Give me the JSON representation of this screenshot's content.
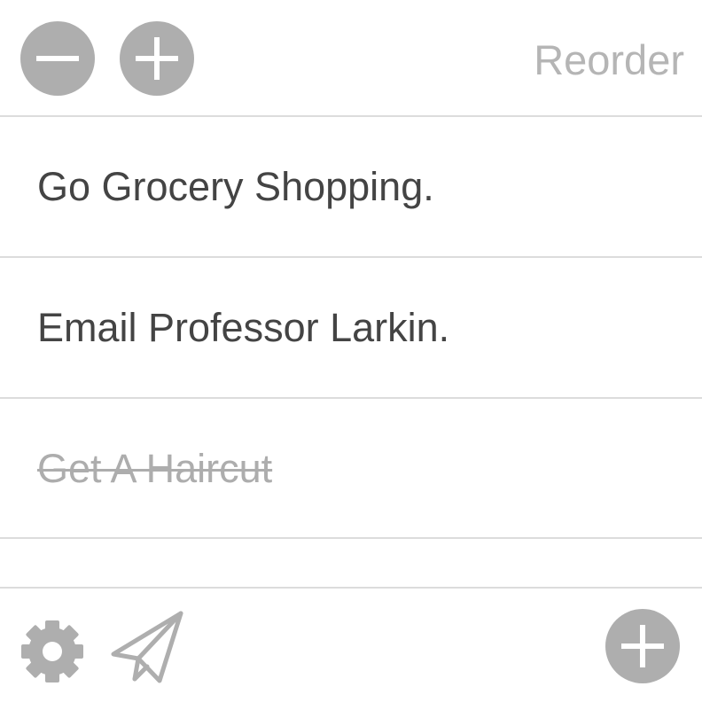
{
  "toolbar": {
    "reorder_label": "Reorder",
    "icons": [
      "minus-icon",
      "plus-icon"
    ]
  },
  "tasks": [
    {
      "text": "Go Grocery Shopping.",
      "completed": false
    },
    {
      "text": "Email Professor Larkin.",
      "completed": false
    },
    {
      "text": "Get A Haircut",
      "completed": true
    }
  ],
  "bottom_bar": {
    "icons": [
      "gear-icon",
      "paper-plane-icon",
      "plus-icon"
    ]
  },
  "colors": {
    "button_gray": "#aeaeae",
    "text_dark": "#444444",
    "text_muted": "#b5b5b5",
    "divider": "#dcdcdc"
  }
}
